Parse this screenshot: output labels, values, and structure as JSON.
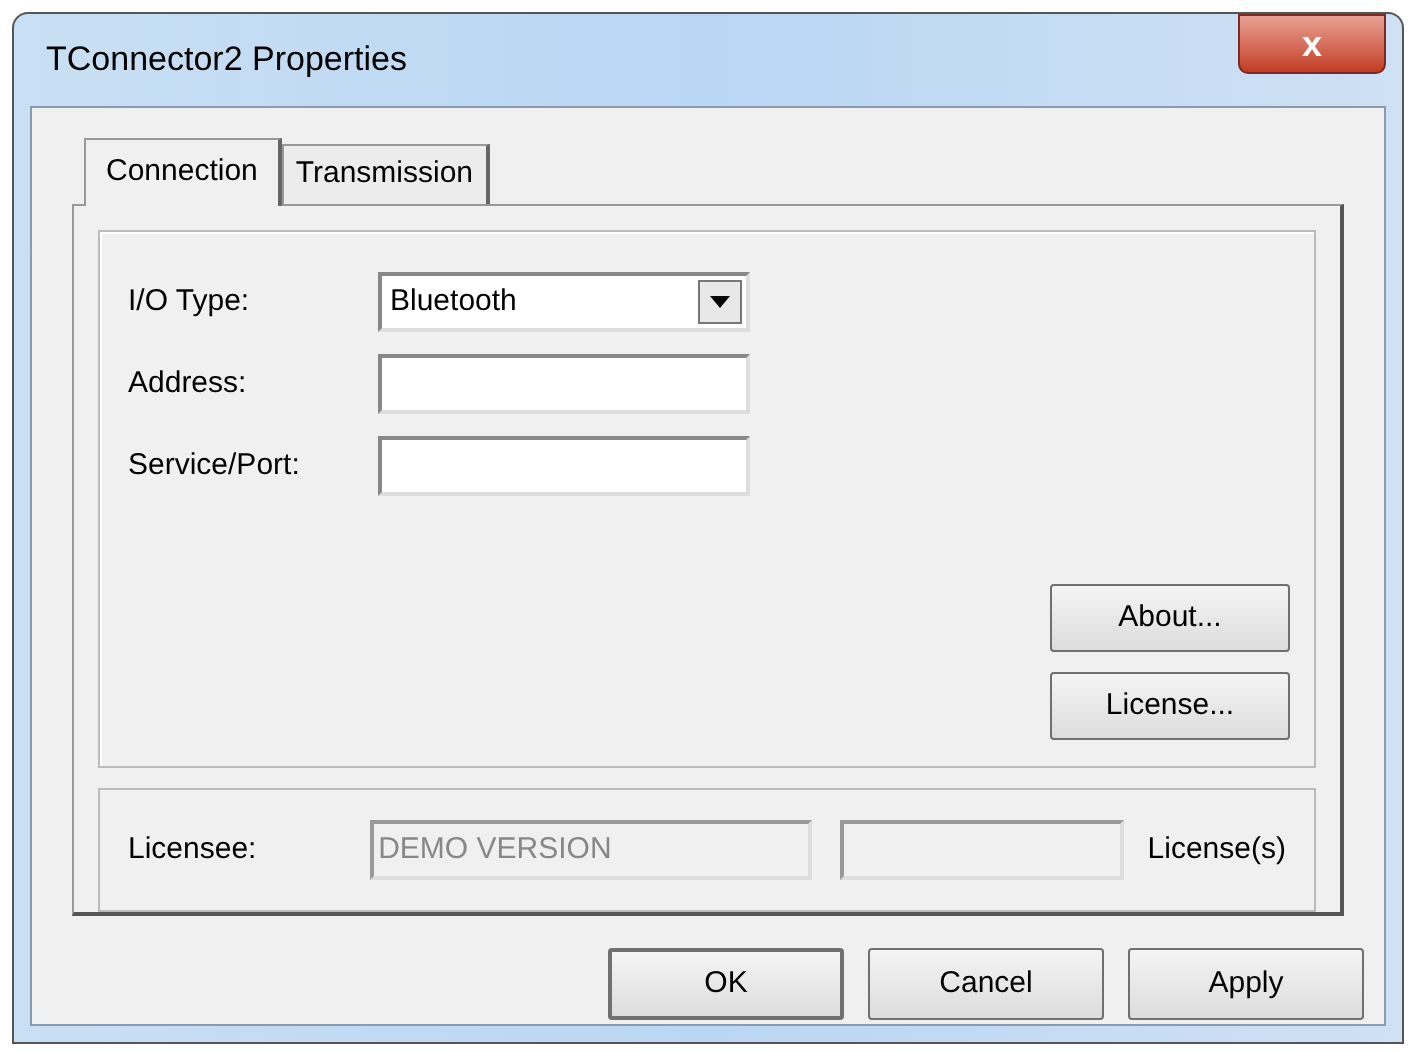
{
  "window": {
    "title": "TConnector2 Properties",
    "close": "x"
  },
  "tabs": [
    {
      "label": "Connection",
      "selected": true
    },
    {
      "label": "Transmission",
      "selected": false
    }
  ],
  "fields": [
    {
      "kind": "dropdown",
      "label": "I/O Type:",
      "value": "Bluetooth"
    },
    {
      "kind": "text",
      "label": "Address:"
    },
    {
      "kind": "text",
      "label": "Service/Port:"
    }
  ],
  "side_buttons": [
    "About...",
    "License..."
  ],
  "license": {
    "label": "Licensee:",
    "licensee": "DEMO VERSION",
    "count_label": "License(s)"
  },
  "buttons": [
    {
      "label": "OK",
      "default": true
    },
    {
      "label": "Cancel",
      "default": false
    },
    {
      "label": "Apply",
      "default": false
    }
  ]
}
